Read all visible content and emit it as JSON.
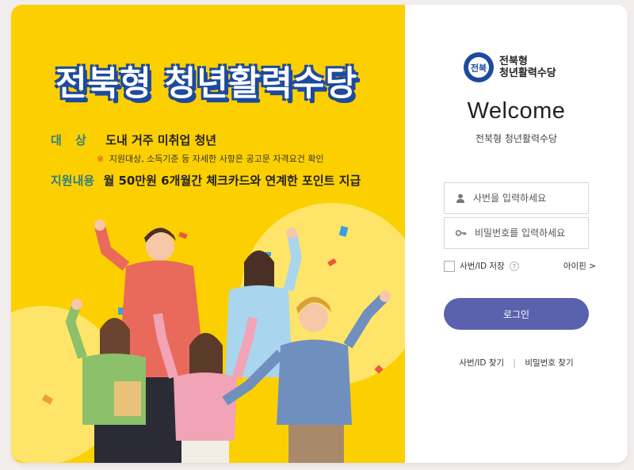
{
  "banner": {
    "title": "전북형 청년활력수당",
    "target_label": "대 상",
    "target_value": "도내 거주 미취업 청년",
    "note_mark": "※",
    "note": "지원대상, 소득기준 등 자세한 사항은 공고문 자격요건 확인",
    "support_label": "지원내용",
    "support_value": "월 50만원 6개월간 체크카드와 연계한 포인트 지급",
    "colors": {
      "background": "#fcd000",
      "title_outline": "#1d4a9e",
      "label": "#2d7f85"
    }
  },
  "logo": {
    "line1": "전북형",
    "line2": "청년활력수당",
    "seal_text": "전북"
  },
  "login": {
    "welcome": "Welcome",
    "subtitle": "전북형 청년활력수당",
    "id_placeholder": "사번을 입력하세요",
    "pw_placeholder": "비밀번호를 입력하세요",
    "save_label": "사번/ID 저장",
    "help_glyph": "?",
    "ipin_label": "아이핀 >",
    "login_button": "로그인",
    "find_id": "사번/ID 찾기",
    "find_sep": "|",
    "find_pw": "비밀번호 찾기",
    "colors": {
      "button": "#5a62ad"
    }
  }
}
